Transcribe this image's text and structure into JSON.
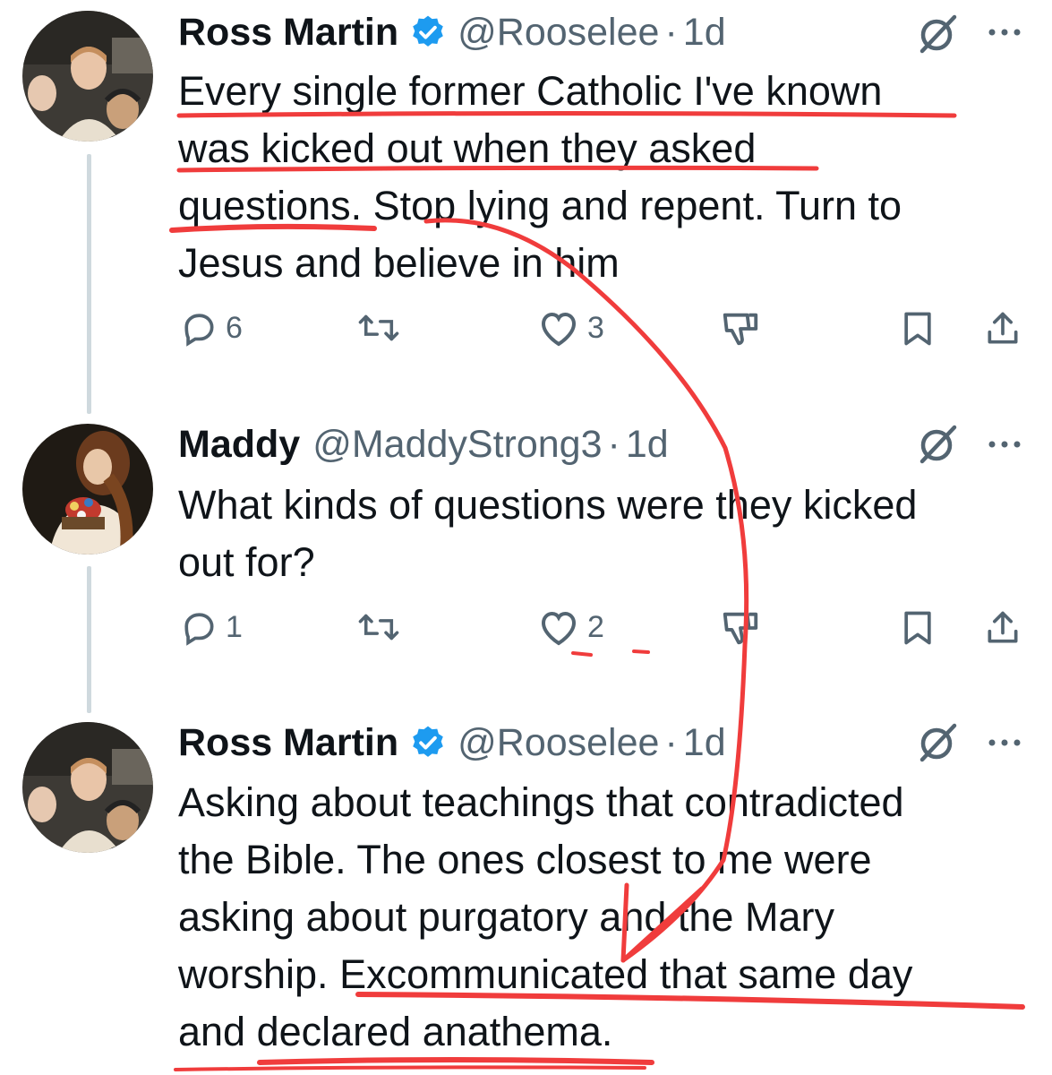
{
  "tweets": [
    {
      "name": "Ross Martin",
      "verified": true,
      "handle": "@Rooselee",
      "dot": "·",
      "time": "1d",
      "lines": [
        "Every single former Catholic I've known",
        "was kicked out when they asked",
        "questions. Stop lying and repent. Turn to",
        "Jesus and believe in him"
      ],
      "replies": "6",
      "retweets": "",
      "likes": "3"
    },
    {
      "name": "Maddy",
      "verified": false,
      "handle": "@MaddyStrong3",
      "dot": "·",
      "time": "1d",
      "lines": [
        "What kinds of questions were they kicked",
        "out for?"
      ],
      "replies": "1",
      "retweets": "",
      "likes": "2"
    },
    {
      "name": "Ross Martin",
      "verified": true,
      "handle": "@Rooselee",
      "dot": "·",
      "time": "1d",
      "lines": [
        "Asking about teachings that contradicted",
        "the Bible. The ones closest to me were",
        "asking about purgatory and the Mary",
        "worship. Excommunicated that same day",
        "and declared anathema."
      ]
    }
  ],
  "icons": {
    "reply": "reply-icon",
    "retweet": "retweet-icon",
    "like": "heart-icon",
    "dislike": "thumbs-down-icon",
    "bookmark": "bookmark-icon",
    "share": "share-icon",
    "grok": "grok-icon",
    "more": "more-icon"
  },
  "colors": {
    "verified": "#1d9bf0",
    "annotation": "#f03c3c",
    "text": "#0f1419",
    "muted": "#536471",
    "thread_line": "#cfd9de"
  }
}
